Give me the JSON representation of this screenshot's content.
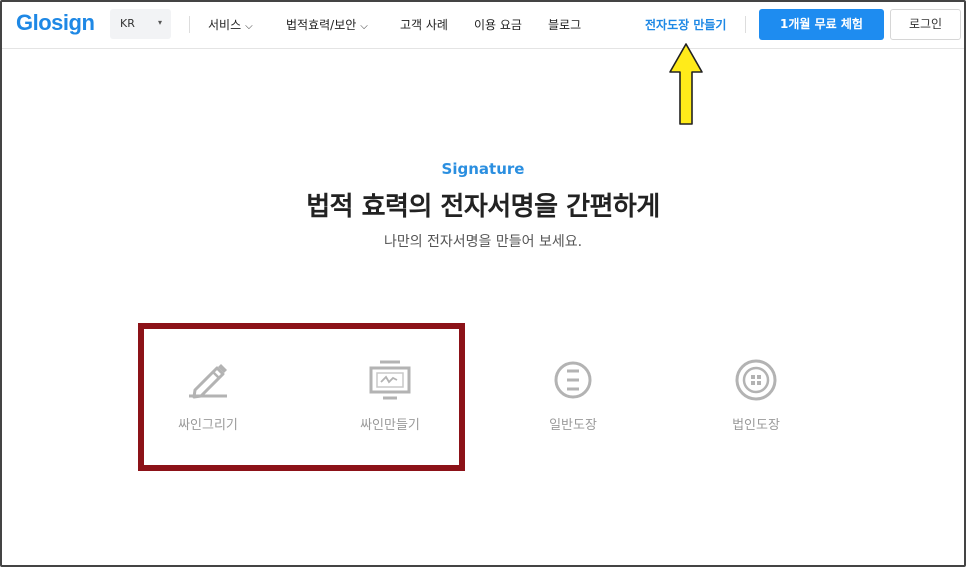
{
  "header": {
    "logo": "Glosign",
    "language": "KR",
    "nav": [
      {
        "label": "서비스",
        "has_dropdown": true
      },
      {
        "label": "법적효력/보안",
        "has_dropdown": true
      },
      {
        "label": "고객 사례",
        "has_dropdown": false
      },
      {
        "label": "이용 요금",
        "has_dropdown": false
      },
      {
        "label": "블로그",
        "has_dropdown": false
      }
    ],
    "make_stamp_link": "전자도장 만들기",
    "trial_button": "1개월 무료 체험",
    "login_button": "로그인"
  },
  "hero": {
    "eyebrow": "Signature",
    "headline": "법적 효력의 전자서명을 간편하게",
    "subline": "나만의 전자서명을 만들어 보세요."
  },
  "options": [
    {
      "label": "싸인그리기",
      "icon": "pen-draw-icon"
    },
    {
      "label": "싸인만들기",
      "icon": "monitor-signature-icon"
    },
    {
      "label": "일반도장",
      "icon": "general-stamp-icon"
    },
    {
      "label": "법인도장",
      "icon": "corporate-stamp-icon"
    }
  ],
  "colors": {
    "brand_blue": "#1e88e5",
    "arrow_yellow": "#ffeb1a",
    "highlight_red": "#8c1218",
    "icon_gray": "#b3b3b3"
  }
}
